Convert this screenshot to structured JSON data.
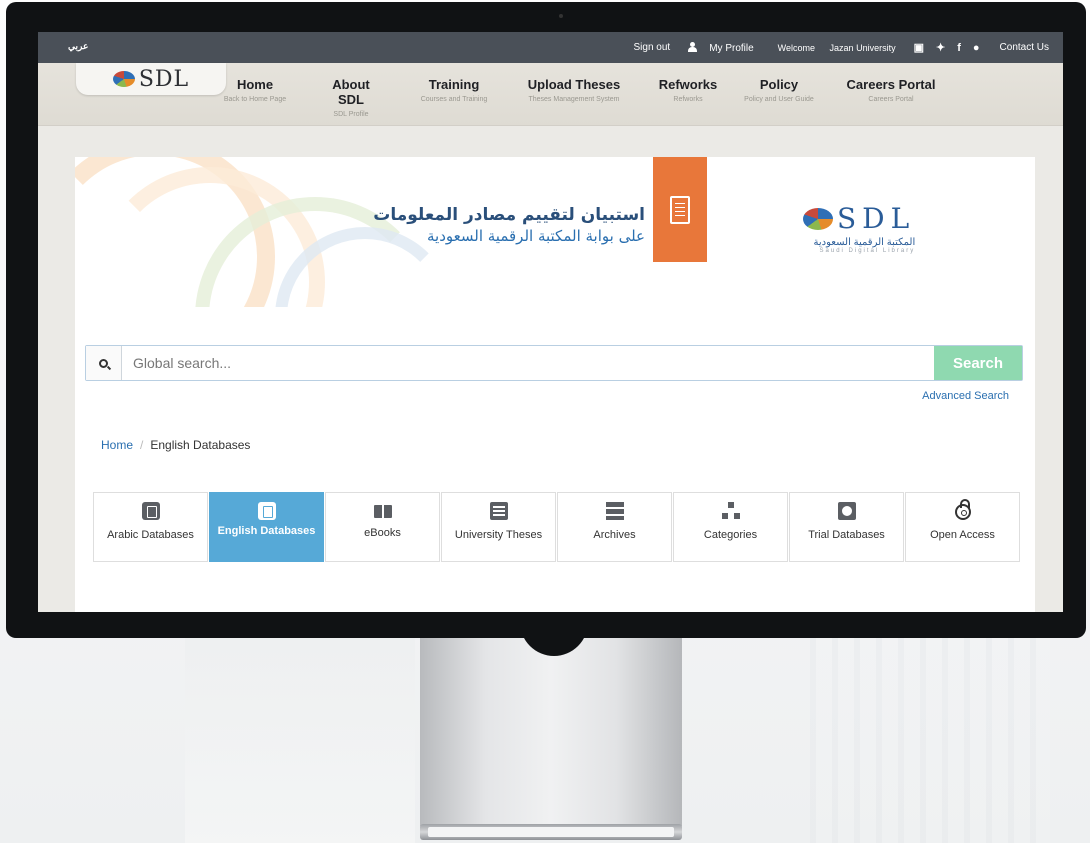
{
  "topbar": {
    "lang_link": "عربي",
    "sign_out": "Sign out",
    "my_profile": "My Profile",
    "welcome": "Welcome",
    "user": "Jazan University",
    "contact": "Contact Us"
  },
  "logo": {
    "text": "SDL"
  },
  "nav": [
    {
      "title": "Home",
      "sub": "Back to Home Page"
    },
    {
      "title": "About SDL",
      "sub": "SDL Profile"
    },
    {
      "title": "Training",
      "sub": "Courses and Training"
    },
    {
      "title": "Upload Theses",
      "sub": "Theses Management System"
    },
    {
      "title": "Refworks",
      "sub": "Refworks"
    },
    {
      "title": "Policy",
      "sub": "Policy and User Guide"
    },
    {
      "title": "Careers Portal",
      "sub": "Careers Portal"
    }
  ],
  "banner": {
    "line1": "استبيان لتقييم مصادر المعلومات",
    "line2": "على بوابة المكتبة الرقمية السعودية",
    "logo_big": "SDL",
    "logo_ar": "المكتبة الرقمية السعودية",
    "logo_en": "Saudi Digital Library"
  },
  "search": {
    "placeholder": "Global search...",
    "button": "Search",
    "advanced": "Advanced Search"
  },
  "breadcrumb": {
    "home": "Home",
    "separator": "/",
    "current": "English Databases"
  },
  "tiles": [
    {
      "label": "Arabic Databases",
      "active": false
    },
    {
      "label": "English Databases",
      "active": true
    },
    {
      "label": "eBooks",
      "active": false
    },
    {
      "label": "University Theses",
      "active": false
    },
    {
      "label": "Archives",
      "active": false
    },
    {
      "label": "Categories",
      "active": false
    },
    {
      "label": "Trial Databases",
      "active": false
    },
    {
      "label": "Open Access",
      "active": false
    }
  ],
  "colors": {
    "topbar": "#4a5058",
    "accent_orange": "#e8773a",
    "active_tile": "#56a9d7",
    "search_button": "#8fd9b0",
    "link": "#2a6fb0"
  }
}
